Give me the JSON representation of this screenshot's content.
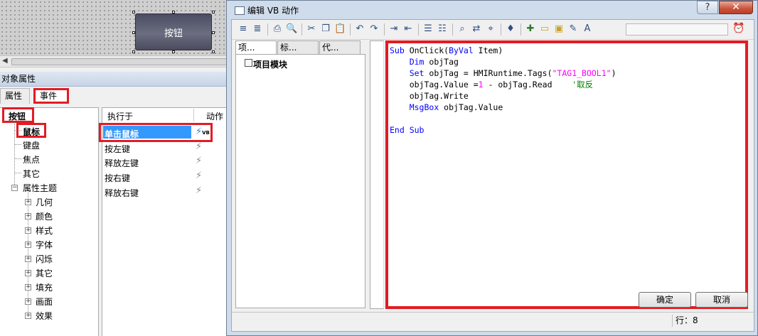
{
  "canvas": {
    "hmi_button_label": "按钮"
  },
  "properties_panel": {
    "title": "对象属性",
    "tabs": [
      "属性",
      "事件"
    ],
    "tree": {
      "root": "按钮",
      "items": [
        "鼠标",
        "键盘",
        "焦点",
        "其它"
      ],
      "group": "属性主题",
      "sub_items": [
        "几何",
        "颜色",
        "样式",
        "字体",
        "闪烁",
        "其它",
        "填充",
        "画面",
        "效果"
      ]
    },
    "events_table": {
      "headers": [
        "执行于",
        "动作"
      ],
      "rows": [
        "单击鼠标",
        "按左键",
        "释放左键",
        "按右键",
        "释放右键"
      ],
      "selected_row": "单击鼠标"
    }
  },
  "dialog": {
    "title": "编辑 VB 动作",
    "help_label": "?",
    "close_label": "✕",
    "project_tabs": [
      "项...",
      "标...",
      "代..."
    ],
    "project_item": "项目模块",
    "code": [
      [
        {
          "t": "kw",
          "v": "Sub "
        },
        {
          "t": "txt",
          "v": "OnClick("
        },
        {
          "t": "kw",
          "v": "ByVal"
        },
        {
          "t": "txt",
          "v": " Item)"
        }
      ],
      [
        {
          "t": "txt",
          "v": "    "
        },
        {
          "t": "kw",
          "v": "Dim"
        },
        {
          "t": "txt",
          "v": " objTag"
        }
      ],
      [
        {
          "t": "txt",
          "v": "    "
        },
        {
          "t": "kw",
          "v": "Set"
        },
        {
          "t": "txt",
          "v": " objTag = HMIRuntime.Tags("
        },
        {
          "t": "str",
          "v": "\"TAG1_BOOL1\""
        },
        {
          "t": "txt",
          "v": ")"
        }
      ],
      [
        {
          "t": "txt",
          "v": "    objTag.Value ="
        },
        {
          "t": "num",
          "v": "1"
        },
        {
          "t": "txt",
          "v": " - objTag.Read    "
        },
        {
          "t": "cmt",
          "v": "'取反"
        }
      ],
      [
        {
          "t": "txt",
          "v": "    objTag.Write"
        }
      ],
      [
        {
          "t": "txt",
          "v": "    "
        },
        {
          "t": "kw",
          "v": "MsgBox"
        },
        {
          "t": "txt",
          "v": " objTag.Value"
        }
      ],
      [],
      [
        {
          "t": "kw",
          "v": "End Sub"
        }
      ]
    ],
    "ok_label": "确定",
    "cancel_label": "取消",
    "status": "行：8"
  },
  "colors": {
    "highlight_red": "#e31b23",
    "selection_blue": "#3399ff",
    "keyword_blue": "#0000ff",
    "string_magenta": "#ff00ff",
    "comment_green": "#008000"
  }
}
